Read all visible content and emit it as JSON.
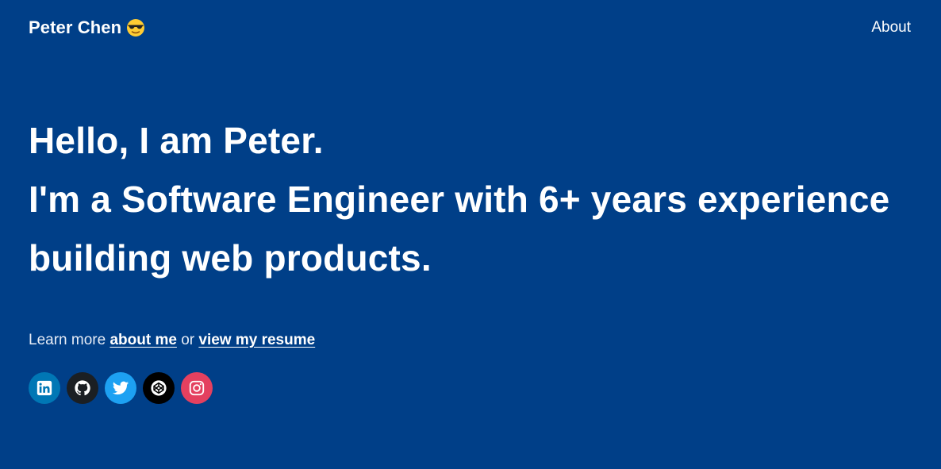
{
  "nav": {
    "brand": "Peter Chen",
    "brand_icon": "sunglasses-emoji-icon",
    "about_link": "About"
  },
  "hero": {
    "line1": "Hello, I am Peter.",
    "line2": "I'm a Software Engineer with 6+ years experience",
    "line3": "building web products."
  },
  "learn_more": {
    "prefix": "Learn more",
    "about_link": "about me",
    "separator": "or",
    "resume_link": "view my resume"
  },
  "socials": [
    {
      "name": "linkedin",
      "icon": "linkedin-icon",
      "color": "#0077b5"
    },
    {
      "name": "github",
      "icon": "github-icon",
      "color": "#1b1f23"
    },
    {
      "name": "twitter",
      "icon": "twitter-icon",
      "color": "#1da1f2"
    },
    {
      "name": "codepen",
      "icon": "codepen-icon",
      "color": "#000000"
    },
    {
      "name": "instagram",
      "icon": "instagram-icon",
      "color": "#e4405f"
    }
  ],
  "colors": {
    "background": "#003f88",
    "text": "#ffffff"
  }
}
